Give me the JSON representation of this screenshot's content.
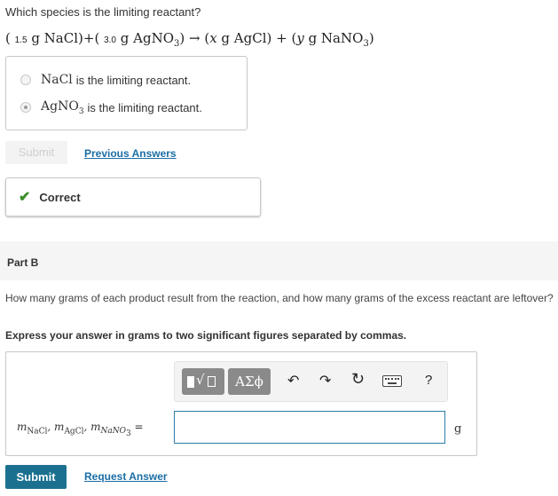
{
  "question": "Which species is the limiting reactant?",
  "equation": {
    "open1": "( ",
    "mass1": "1.5",
    "g1": "g NaCl)+( ",
    "mass2": "3.0",
    "g2": "g AgNO",
    "sub2": "3",
    "arrow": ") → (",
    "x_part": "x",
    "g3": " g AgCl) + (",
    "y_part": "y",
    "g4": " g NaNO",
    "sub4": "3",
    "close": ")"
  },
  "options": [
    {
      "chem": "NaCl",
      "sub": "",
      "text": " is the limiting reactant.",
      "selected": false
    },
    {
      "chem": "AgNO",
      "sub": "3",
      "text": " is the limiting reactant.",
      "selected": true
    }
  ],
  "partA": {
    "submit_label": "Submit",
    "previous_answers_label": "Previous Answers",
    "feedback_label": "Correct"
  },
  "partB": {
    "title": "Part B",
    "question": "How many grams of each product result from the reaction, and how many grams of the excess reactant are leftover?",
    "instruction": "Express your answer in grams to two significant figures separated by commas.",
    "toolbar": {
      "symbols_label": "ΑΣϕ",
      "undo": "↶",
      "redo": "↷",
      "reset": "↻",
      "help": "?"
    },
    "mass_label": {
      "m1": "m",
      "s1": "NaCl",
      "sep1": ", ",
      "m2": "m",
      "s2": "AgCl",
      "sep2": ", ",
      "m3": "m",
      "s3": "NaNO",
      "s3sub": "3",
      "eq": " ="
    },
    "answer_value": "",
    "unit": "g",
    "submit_label": "Submit",
    "request_answer_label": "Request Answer"
  },
  "colors": {
    "accent": "#1b7090",
    "link": "#1b6ea5",
    "correct": "#3a8c2b"
  }
}
